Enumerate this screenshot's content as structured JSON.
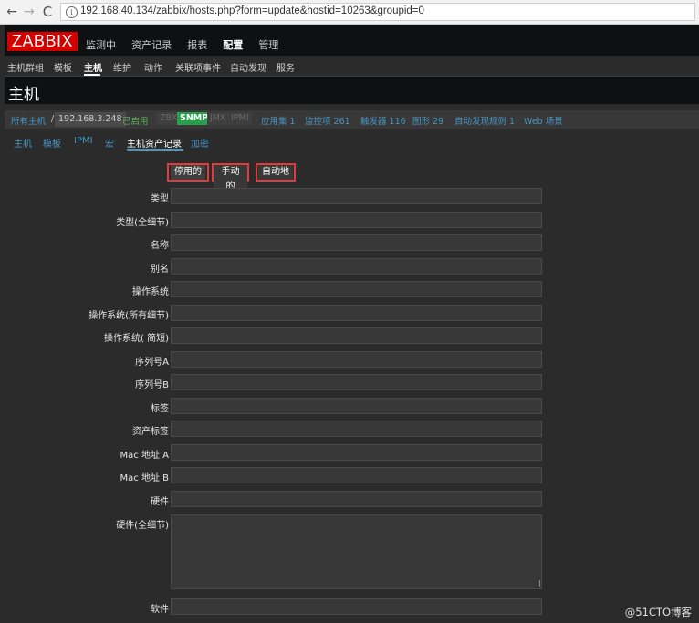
{
  "browser": {
    "back_icon": "←",
    "forward_icon": "→",
    "reload_icon": "C",
    "info_icon": "i",
    "url": "192.168.40.134/zabbix/hosts.php?form=update&hostid=10263&groupid=0"
  },
  "app": {
    "logo": "ZABBIX",
    "main_menu": [
      "监测中",
      "资产记录",
      "报表",
      "配置",
      "管理"
    ],
    "active_main": "配置",
    "sub_menu": [
      "主机群组",
      "模板",
      "主机",
      "维护",
      "动作",
      "关联项事件",
      "自动发现",
      "服务"
    ],
    "active_sub": "主机",
    "page_title": "主机"
  },
  "breadcrumbs": {
    "all_hosts": "所有主机",
    "separator": "/",
    "host_ip": "192.168.3.248",
    "status": "已启用",
    "badges": {
      "zbx": "ZBX",
      "snmp": "SNMP",
      "jmx": "JMX",
      "ipmi": "IPMI"
    },
    "links": [
      "应用集 1",
      "监控项 261",
      "触发器 116",
      "图形 29",
      "自动发现规则 1",
      "Web 场景"
    ]
  },
  "tabs": [
    "主机",
    "模板",
    "IPMI",
    "宏",
    "主机资产记录",
    "加密"
  ],
  "active_tab": "主机资产记录",
  "inventory_mode": {
    "options": [
      "停用的",
      "手动的",
      "自动地"
    ],
    "selected": "停用的"
  },
  "fields": [
    {
      "label": "类型",
      "value": ""
    },
    {
      "label": "类型(全细节)",
      "value": ""
    },
    {
      "label": "名称",
      "value": ""
    },
    {
      "label": "别名",
      "value": ""
    },
    {
      "label": "操作系统",
      "value": ""
    },
    {
      "label": "操作系统(所有细节)",
      "value": ""
    },
    {
      "label": "操作系统( 简短)",
      "value": ""
    },
    {
      "label": "序列号A",
      "value": ""
    },
    {
      "label": "序列号B",
      "value": ""
    },
    {
      "label": "标签",
      "value": ""
    },
    {
      "label": "资产标签",
      "value": ""
    },
    {
      "label": "Mac 地址 A",
      "value": ""
    },
    {
      "label": "Mac 地址 B",
      "value": ""
    },
    {
      "label": "硬件",
      "value": ""
    },
    {
      "label": "硬件(全细节)",
      "value": ""
    },
    {
      "label": "软件",
      "value": ""
    }
  ],
  "watermark": "@51CTO博客",
  "colors": {
    "accent_red": "#d40000",
    "link_blue": "#4796c4",
    "status_green": "#59b35a",
    "snmp_green": "#289f4a",
    "highlight_red": "#e23b3b"
  }
}
